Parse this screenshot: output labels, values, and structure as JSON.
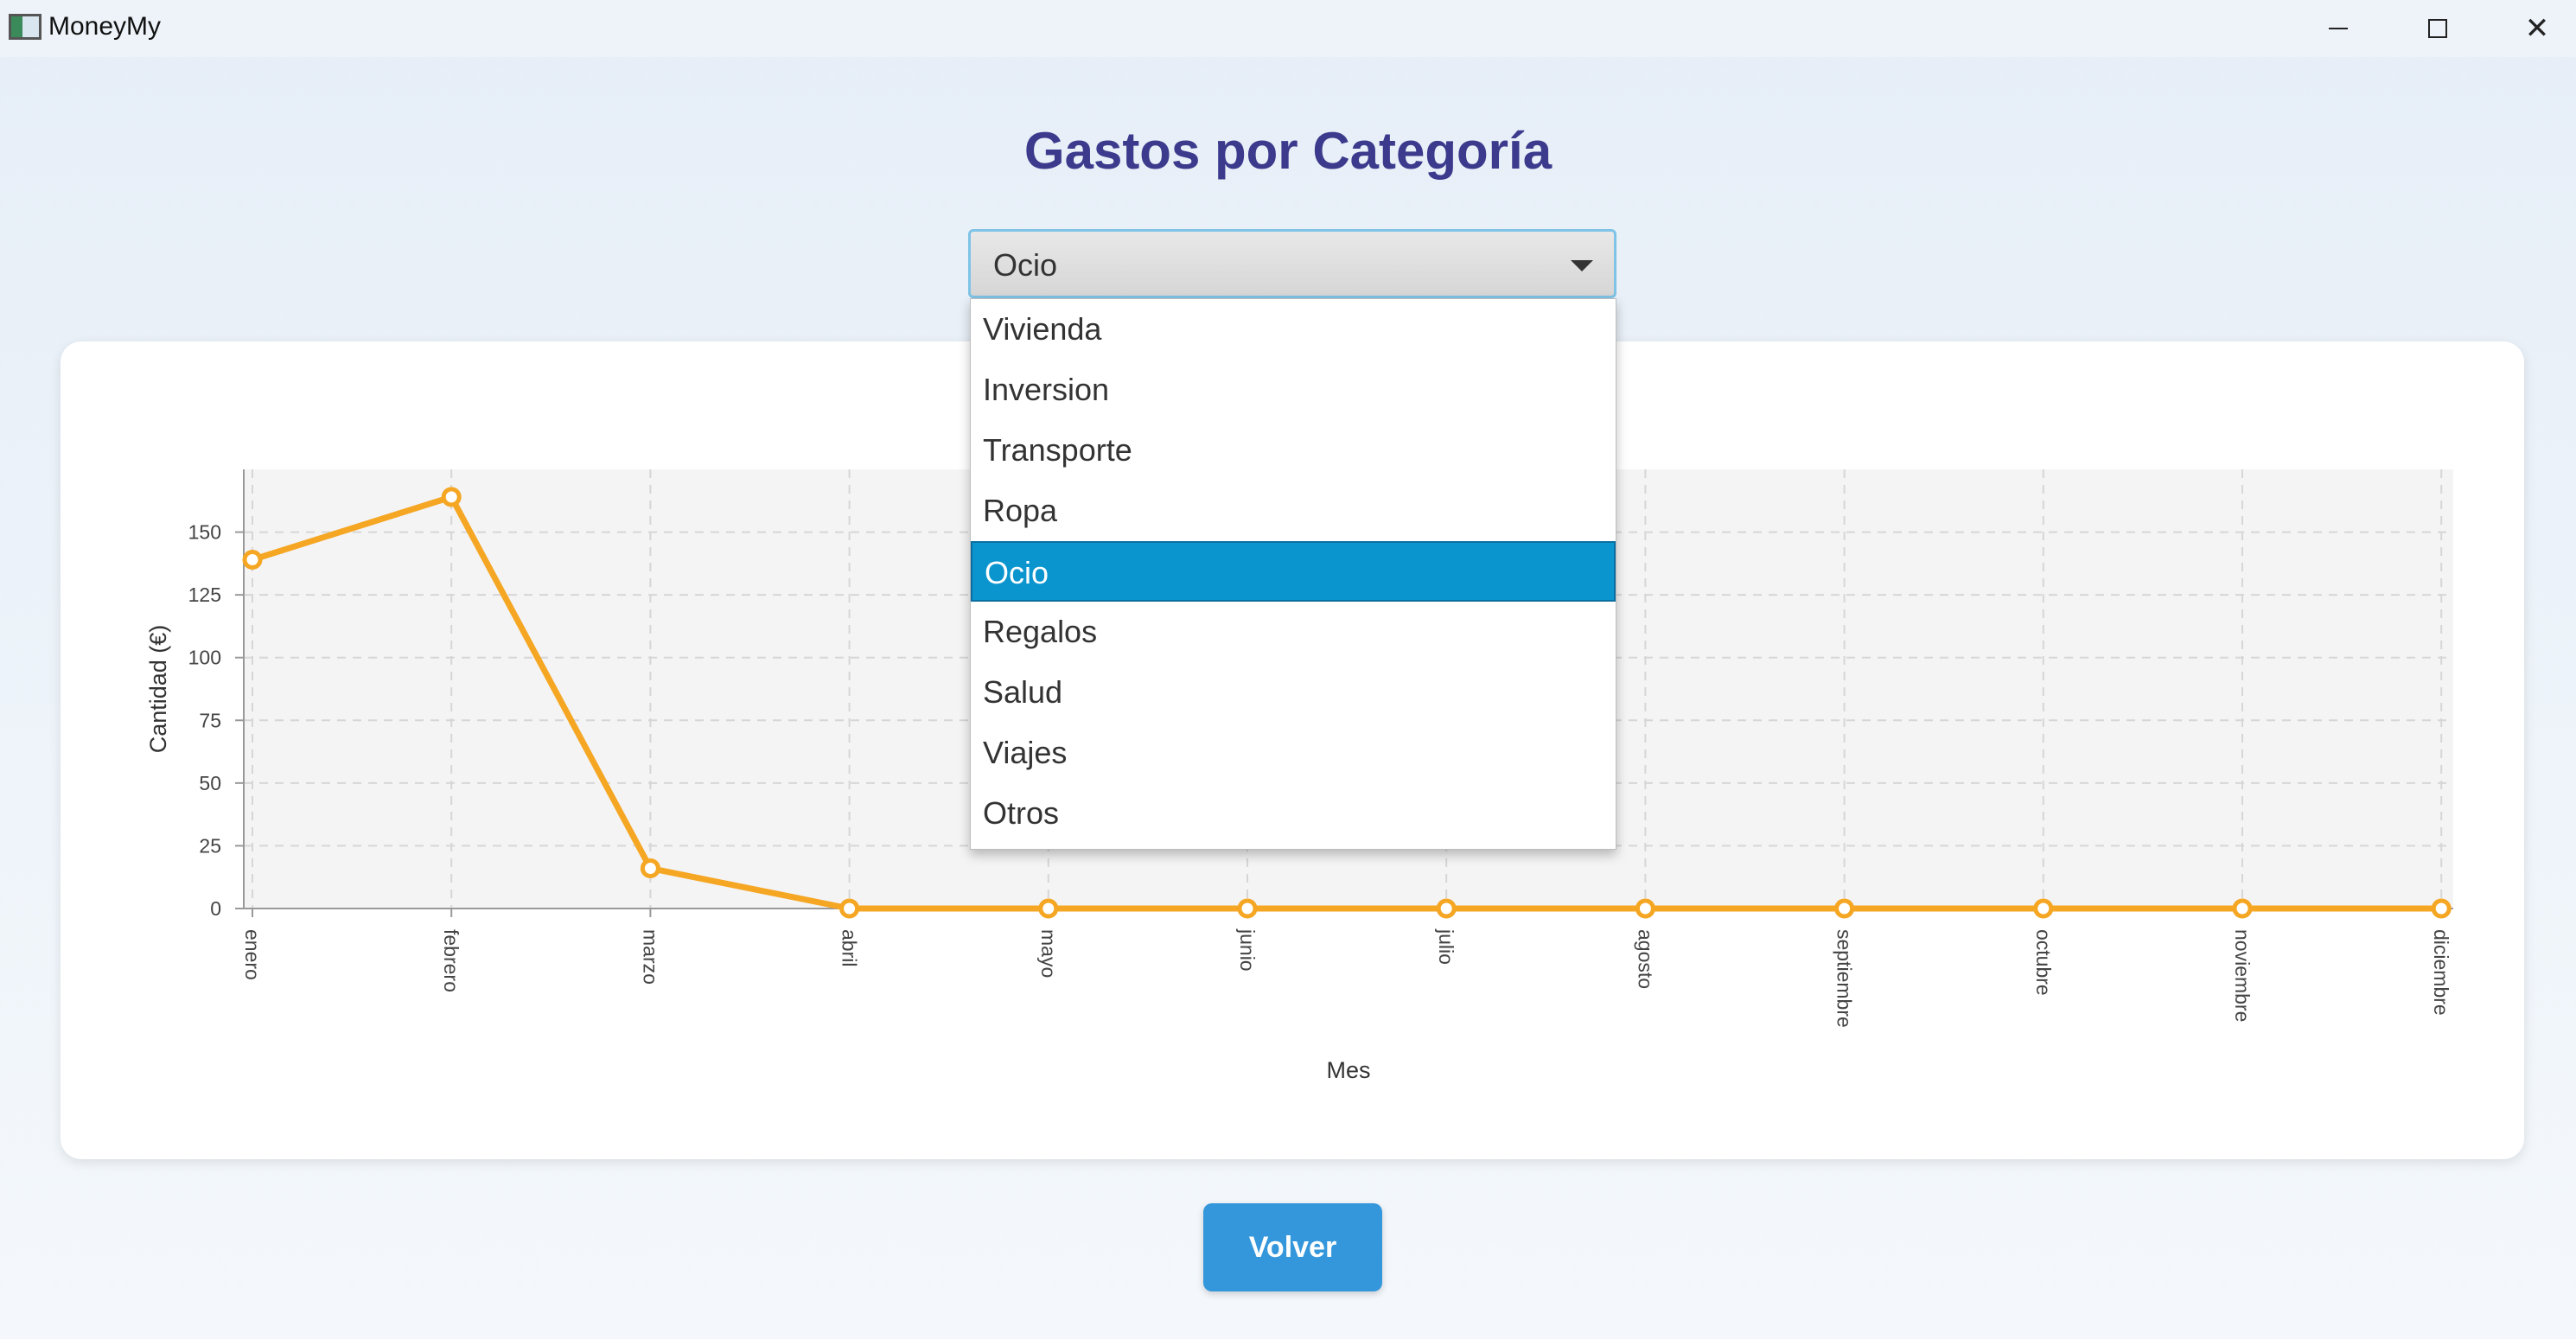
{
  "window": {
    "title": "MoneyMy"
  },
  "page": {
    "title": "Gastos por Categoría"
  },
  "combo": {
    "selected": "Ocio",
    "options": [
      "Vivienda",
      "Inversion",
      "Transporte",
      "Ropa",
      "Ocio",
      "Regalos",
      "Salud",
      "Viajes",
      "Otros"
    ],
    "selected_index": 4
  },
  "button": {
    "label": "Volver"
  },
  "colors": {
    "line": "#f5a623",
    "title": "#3b3a8c",
    "selection": "#0a95cf",
    "button": "#3497db"
  },
  "chart_data": {
    "type": "line",
    "xlabel": "Mes",
    "ylabel": "Cantidad (€)",
    "categories": [
      "enero",
      "febrero",
      "marzo",
      "abril",
      "mayo",
      "junio",
      "julio",
      "agosto",
      "septiembre",
      "octubre",
      "noviembre",
      "diciembre"
    ],
    "series": [
      {
        "values": [
          139,
          164,
          16,
          0,
          0,
          0,
          0,
          0,
          0,
          0,
          0,
          0
        ]
      }
    ],
    "ylim": [
      0,
      175
    ],
    "yticks": [
      0,
      25,
      50,
      75,
      100,
      125,
      150
    ],
    "grid": true
  }
}
